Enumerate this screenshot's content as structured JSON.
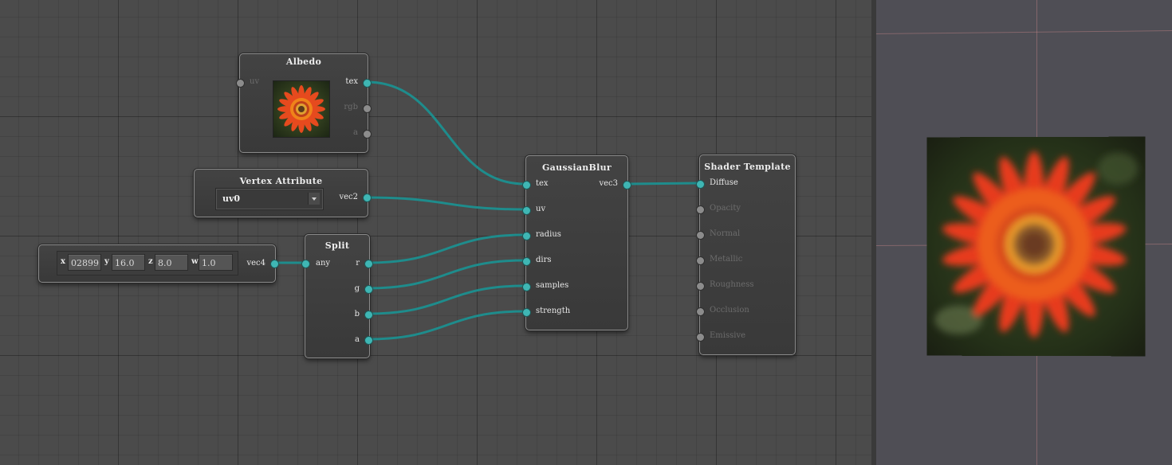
{
  "nodes": {
    "albedo": {
      "title": "Albedo",
      "inputs": [
        "uv"
      ],
      "outputs": [
        "tex",
        "rgb",
        "a"
      ]
    },
    "vertex_attribute": {
      "title": "Vertex Attribute",
      "selected": "uv0",
      "outputs": [
        "vec2"
      ]
    },
    "vector": {
      "labels": [
        "x",
        "y",
        "z",
        "w"
      ],
      "values": [
        "02899",
        "16.0",
        "8.0",
        "1.0"
      ],
      "outputs": [
        "vec4"
      ]
    },
    "split": {
      "title": "Split",
      "inputs": [
        "any"
      ],
      "outputs": [
        "r",
        "g",
        "b",
        "a"
      ]
    },
    "gaussian_blur": {
      "title": "GaussianBlur",
      "inputs": [
        "tex",
        "uv",
        "radius",
        "dirs",
        "samples",
        "strength"
      ],
      "outputs": [
        "vec3"
      ]
    },
    "shader_template": {
      "title": "Shader Template",
      "inputs": [
        "Diffuse",
        "Opacity",
        "Normal",
        "Metallic",
        "Roughness",
        "Occlusion",
        "Emissive"
      ]
    }
  },
  "colors": {
    "connected_port": "#3fb6b4",
    "disconnected_port": "#8c8c8c",
    "wire": "#1e8c8c",
    "canvas": "#4b4b4b",
    "preview_bg": "#4f4e55"
  },
  "icons": {
    "texture_thumbnail": "flower-image",
    "dropdown_arrow": "chevron-down-icon"
  }
}
